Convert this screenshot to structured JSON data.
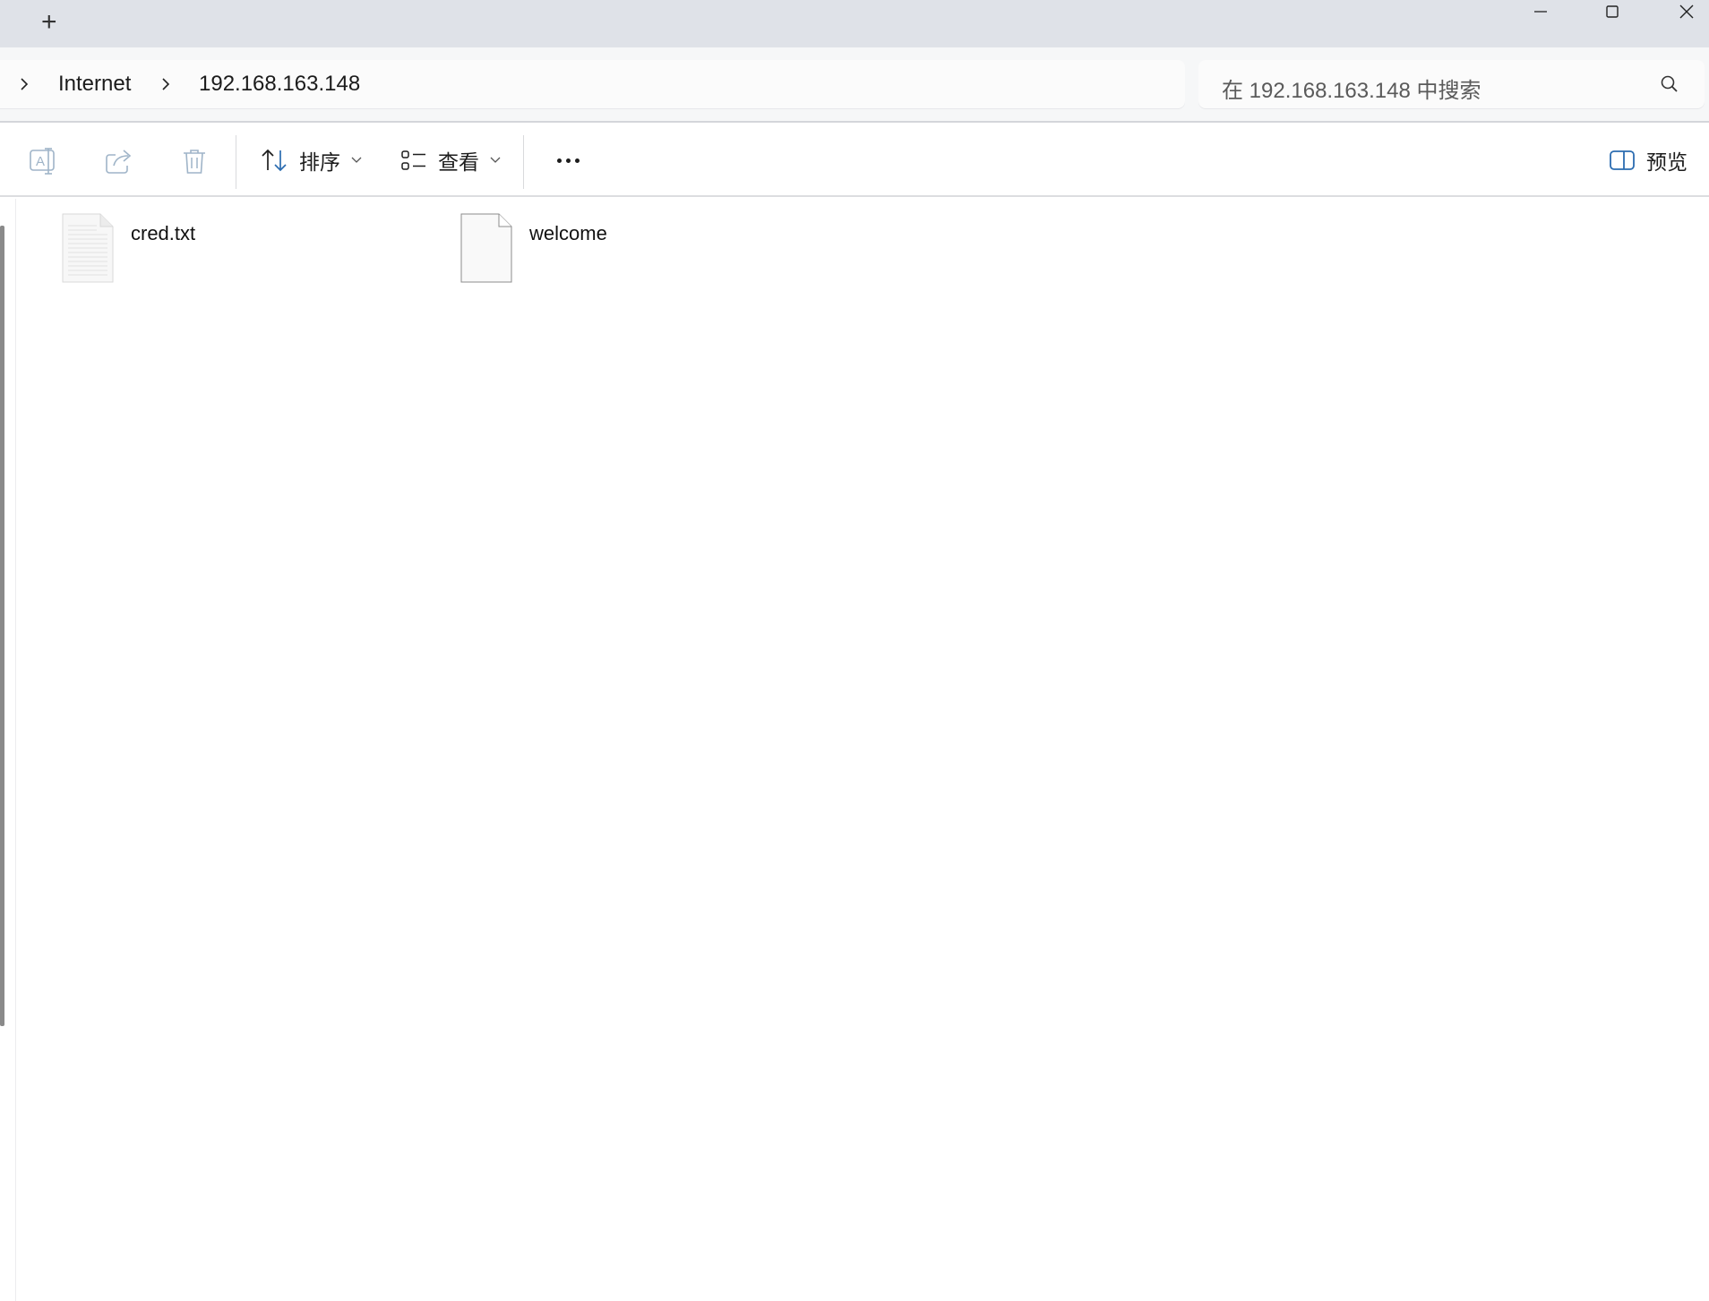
{
  "titlebar": {
    "new_tab_glyph": "+",
    "minimize_icon": "minimize-icon",
    "maximize_icon": "maximize-icon",
    "close_icon": "close-icon"
  },
  "breadcrumb": {
    "items": [
      "Internet",
      "192.168.163.148"
    ]
  },
  "search": {
    "placeholder": "在 192.168.163.148 中搜索"
  },
  "toolbar": {
    "rename_icon": "rename-icon",
    "share_icon": "share-icon",
    "delete_icon": "delete-icon",
    "sort_label": "排序",
    "view_label": "查看",
    "more_icon": "more-icon",
    "preview_label": "预览"
  },
  "files": [
    {
      "name": "cred.txt",
      "icon": "text-document-icon"
    },
    {
      "name": "welcome",
      "icon": "blank-document-icon"
    }
  ],
  "colors": {
    "titlebar_bg": "#dfe2e8",
    "nav_bg": "#f6f7f8",
    "accent": "#2b6cb0",
    "disabled_icon": "#9fb4c8"
  }
}
